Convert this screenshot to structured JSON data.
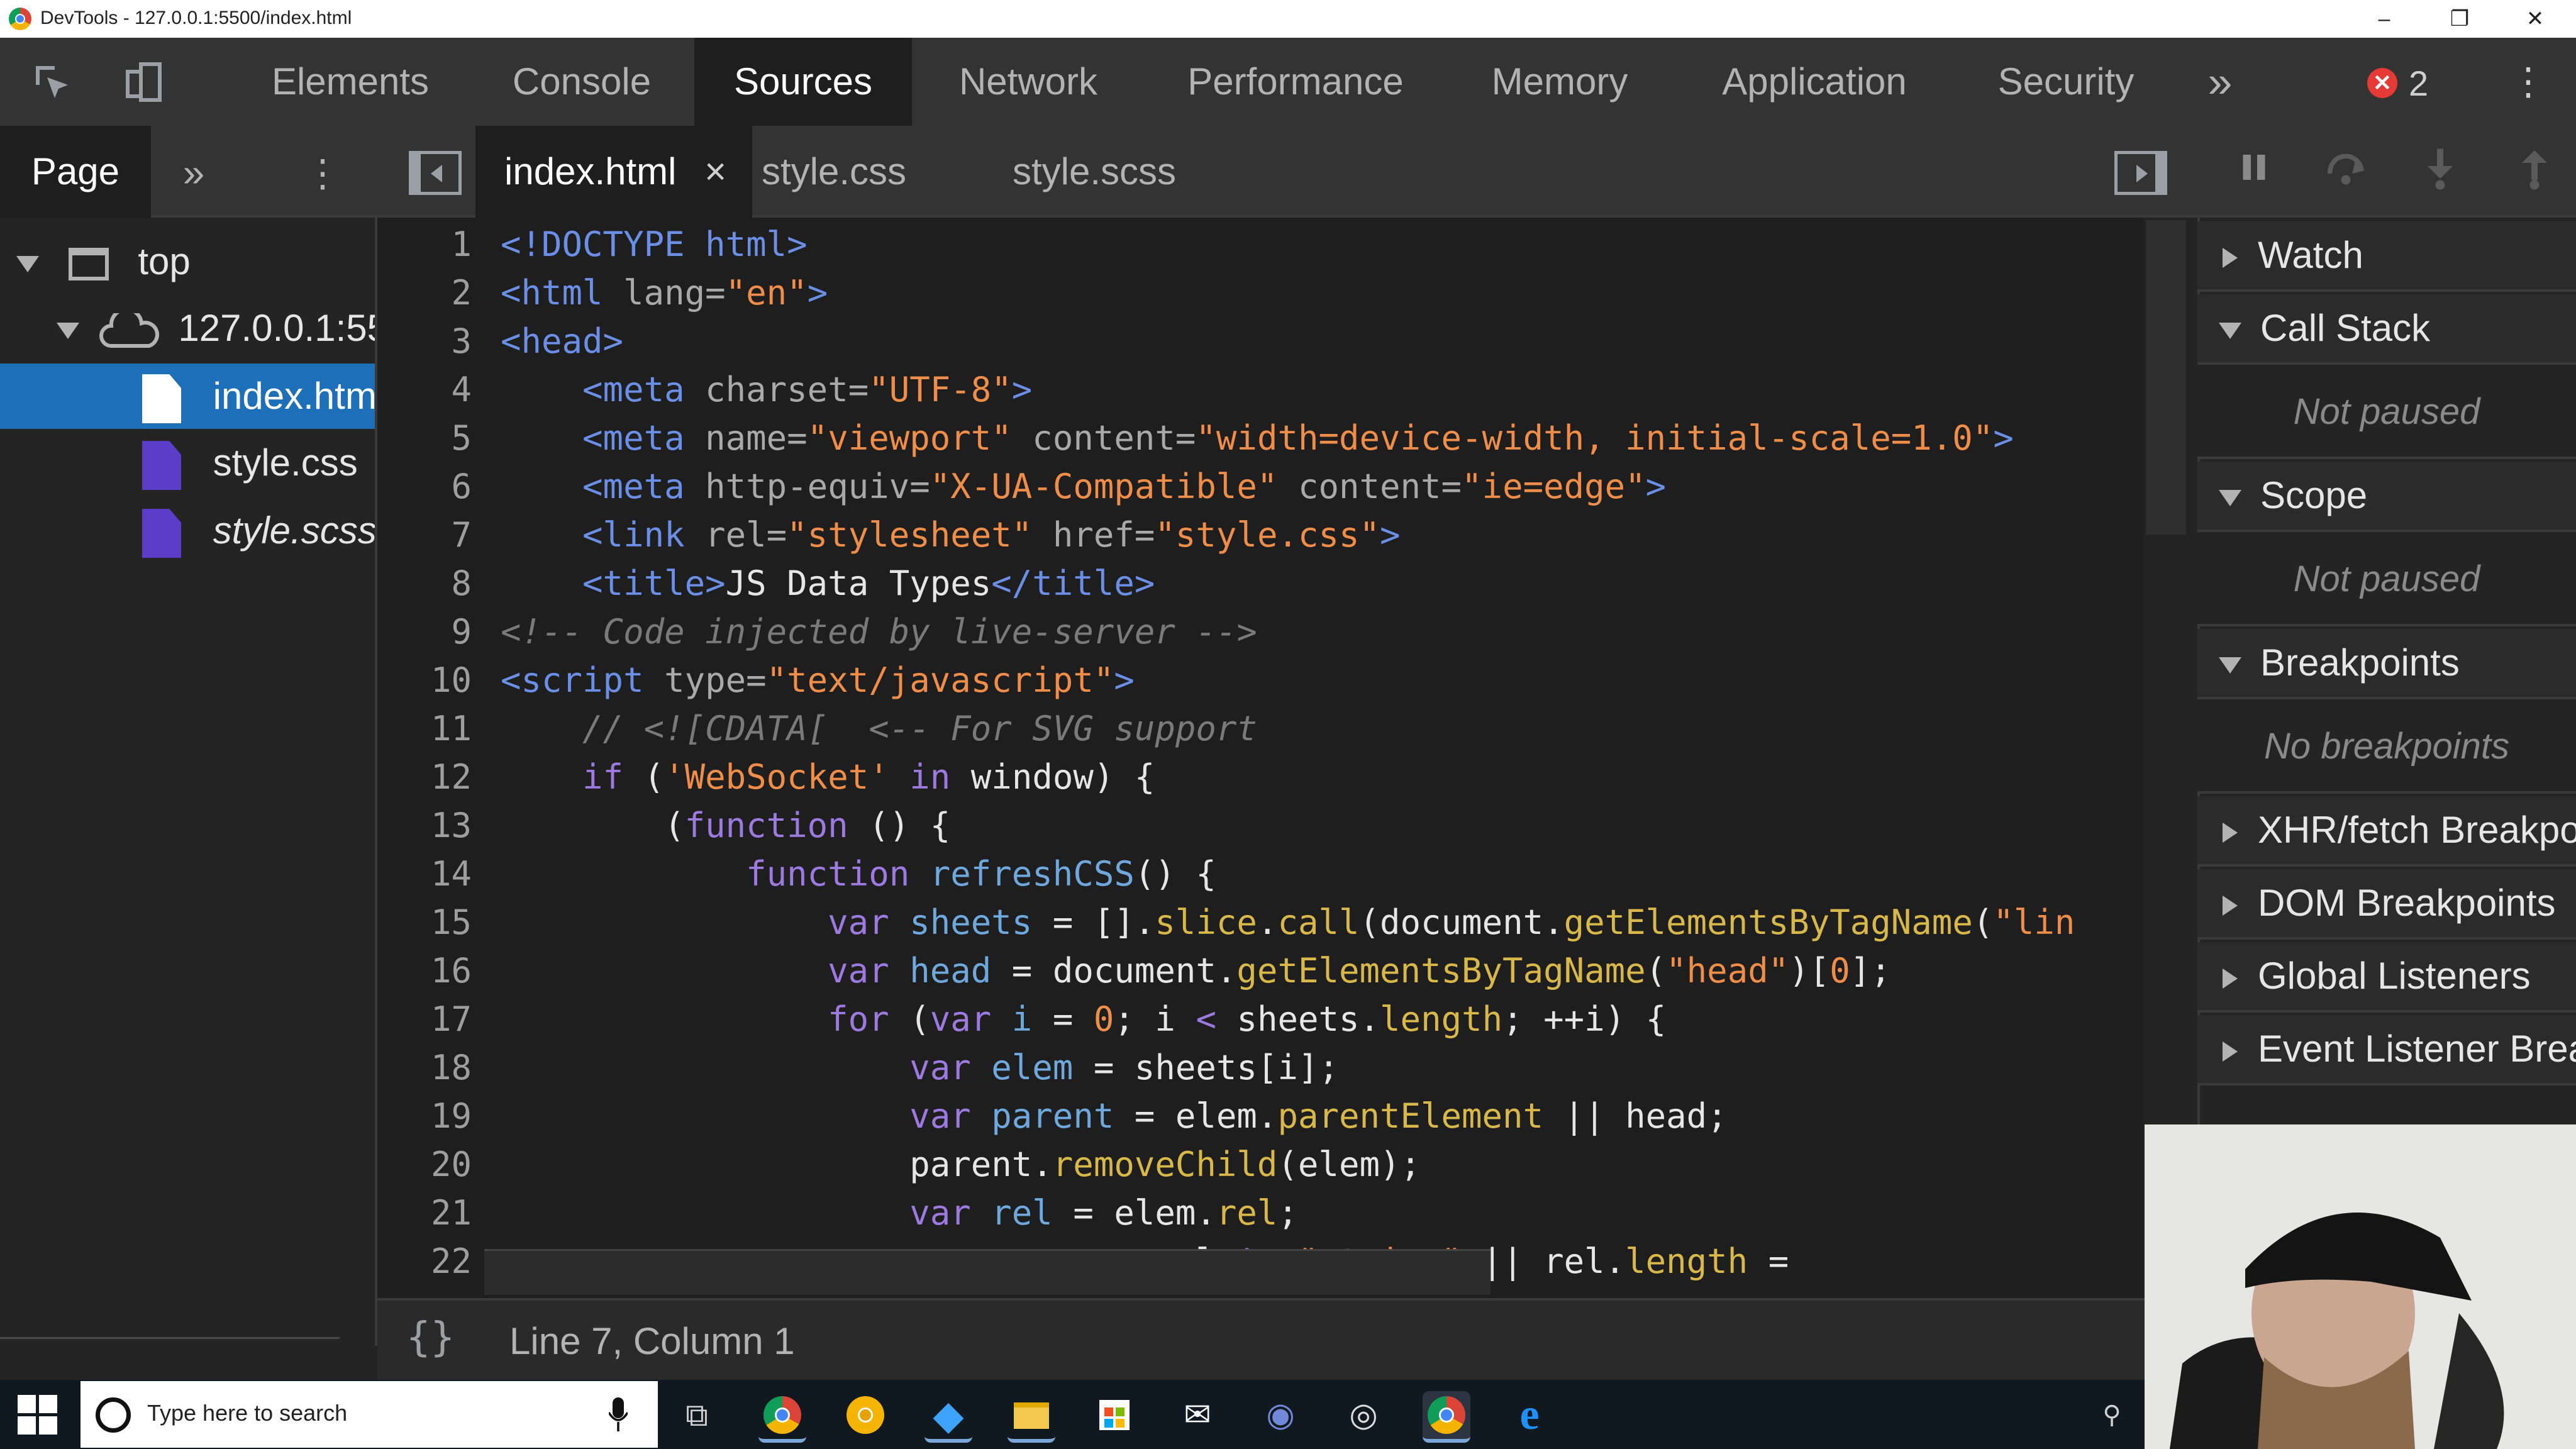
{
  "window": {
    "title": "DevTools - 127.0.0.1:5500/index.html",
    "controls": [
      "–",
      "❐",
      "✕"
    ]
  },
  "toolbar": {
    "inspect_icon": "inspect-element-icon",
    "device_icon": "device-toolbar-icon",
    "tabs": [
      "Elements",
      "Console",
      "Sources",
      "Network",
      "Performance",
      "Memory",
      "Application",
      "Security"
    ],
    "active_tab": "Sources",
    "more_tabs": "»",
    "error_badge": "✕",
    "error_count": "2",
    "menu": "⋮"
  },
  "navigator": {
    "tabs": [
      "Page"
    ],
    "more": "»",
    "menu": "⋮",
    "tree": [
      {
        "label": "top",
        "icon": "frame-icon"
      },
      {
        "label": "127.0.0.1:5500",
        "icon": "cloud-icon"
      },
      {
        "label": "index.html",
        "icon": "html-file-icon",
        "selected": true
      },
      {
        "label": "style.css",
        "icon": "css-file-icon"
      },
      {
        "label": "style.scss",
        "icon": "scss-file-icon"
      }
    ]
  },
  "editor": {
    "tabs": [
      {
        "label": "index.html",
        "close": "×",
        "active": true
      },
      {
        "label": "style.css"
      },
      {
        "label": "style.scss"
      }
    ],
    "line_numbers": [
      "1",
      "2",
      "3",
      "4",
      "5",
      "6",
      "7",
      "8",
      "9",
      "10",
      "11",
      "12",
      "13",
      "14",
      "15",
      "16",
      "17",
      "18",
      "19",
      "20",
      "21",
      "22"
    ],
    "lines": [
      [
        {
          "t": "k",
          "v": "<!DOCTYPE html>"
        }
      ],
      [
        {
          "t": "k",
          "v": "<html "
        },
        {
          "t": "a",
          "v": "lang="
        },
        {
          "t": "s",
          "v": "\"en\""
        },
        {
          "t": "k",
          "v": ">"
        }
      ],
      [
        {
          "t": "k",
          "v": "<head>"
        }
      ],
      [
        {
          "t": "tx",
          "v": "    "
        },
        {
          "t": "k",
          "v": "<meta "
        },
        {
          "t": "a",
          "v": "charset="
        },
        {
          "t": "s",
          "v": "\"UTF-8\""
        },
        {
          "t": "k",
          "v": ">"
        }
      ],
      [
        {
          "t": "tx",
          "v": "    "
        },
        {
          "t": "k",
          "v": "<meta "
        },
        {
          "t": "a",
          "v": "name="
        },
        {
          "t": "s",
          "v": "\"viewport\""
        },
        {
          "t": "a",
          "v": " content="
        },
        {
          "t": "s",
          "v": "\"width=device-width, initial-scale=1.0\""
        },
        {
          "t": "k",
          "v": ">"
        }
      ],
      [
        {
          "t": "tx",
          "v": "    "
        },
        {
          "t": "k",
          "v": "<meta "
        },
        {
          "t": "a",
          "v": "http-equiv="
        },
        {
          "t": "s",
          "v": "\"X-UA-Compatible\""
        },
        {
          "t": "a",
          "v": " content="
        },
        {
          "t": "s",
          "v": "\"ie=edge\""
        },
        {
          "t": "k",
          "v": ">"
        }
      ],
      [
        {
          "t": "tx",
          "v": "    "
        },
        {
          "t": "k",
          "v": "<link "
        },
        {
          "t": "a",
          "v": "rel="
        },
        {
          "t": "s",
          "v": "\"stylesheet\""
        },
        {
          "t": "a",
          "v": " href="
        },
        {
          "t": "s",
          "v": "\"style.css\""
        },
        {
          "t": "k",
          "v": ">"
        }
      ],
      [
        {
          "t": "tx",
          "v": "    "
        },
        {
          "t": "k",
          "v": "<title>"
        },
        {
          "t": "tx",
          "v": "JS Data Types"
        },
        {
          "t": "k",
          "v": "</title>"
        }
      ],
      [
        {
          "t": "c",
          "v": "<!-- Code injected by live-server -->"
        }
      ],
      [
        {
          "t": "k",
          "v": "<script "
        },
        {
          "t": "a",
          "v": "type="
        },
        {
          "t": "s",
          "v": "\"text/javascript\""
        },
        {
          "t": "k",
          "v": ">"
        }
      ],
      [
        {
          "t": "c",
          "v": "    // <![CDATA[  <-- For SVG support"
        }
      ],
      [
        {
          "t": "tx",
          "v": "    "
        },
        {
          "t": "kw",
          "v": "if"
        },
        {
          "t": "tx",
          "v": " ("
        },
        {
          "t": "s",
          "v": "'WebSocket'"
        },
        {
          "t": "kw",
          "v": " in"
        },
        {
          "t": "tx",
          "v": " window) {"
        }
      ],
      [
        {
          "t": "tx",
          "v": "        ("
        },
        {
          "t": "kw",
          "v": "function"
        },
        {
          "t": "tx",
          "v": " () {"
        }
      ],
      [
        {
          "t": "tx",
          "v": "            "
        },
        {
          "t": "kw",
          "v": "function"
        },
        {
          "t": "vr",
          "v": " refreshCSS"
        },
        {
          "t": "tx",
          "v": "() {"
        }
      ],
      [
        {
          "t": "tx",
          "v": "                "
        },
        {
          "t": "kw",
          "v": "var"
        },
        {
          "t": "vr",
          "v": " sheets"
        },
        {
          "t": "tx",
          "v": " = []."
        },
        {
          "t": "fn",
          "v": "slice"
        },
        {
          "t": "tx",
          "v": "."
        },
        {
          "t": "fn",
          "v": "call"
        },
        {
          "t": "tx",
          "v": "(document."
        },
        {
          "t": "fn",
          "v": "getElementsByTagName"
        },
        {
          "t": "tx",
          "v": "("
        },
        {
          "t": "s",
          "v": "\"lin"
        }
      ],
      [
        {
          "t": "tx",
          "v": "                "
        },
        {
          "t": "kw",
          "v": "var"
        },
        {
          "t": "vr",
          "v": " head"
        },
        {
          "t": "tx",
          "v": " = document."
        },
        {
          "t": "fn",
          "v": "getElementsByTagName"
        },
        {
          "t": "tx",
          "v": "("
        },
        {
          "t": "s",
          "v": "\"head\""
        },
        {
          "t": "tx",
          "v": ")["
        },
        {
          "t": "num",
          "v": "0"
        },
        {
          "t": "tx",
          "v": "];"
        }
      ],
      [
        {
          "t": "tx",
          "v": "                "
        },
        {
          "t": "kw",
          "v": "for"
        },
        {
          "t": "tx",
          "v": " ("
        },
        {
          "t": "kw",
          "v": "var"
        },
        {
          "t": "vr",
          "v": " i"
        },
        {
          "t": "tx",
          "v": " = "
        },
        {
          "t": "num",
          "v": "0"
        },
        {
          "t": "tx",
          "v": "; i "
        },
        {
          "t": "kw",
          "v": "<"
        },
        {
          "t": "tx",
          "v": " sheets."
        },
        {
          "t": "fn",
          "v": "length"
        },
        {
          "t": "tx",
          "v": "; ++i) {"
        }
      ],
      [
        {
          "t": "tx",
          "v": "                    "
        },
        {
          "t": "kw",
          "v": "var"
        },
        {
          "t": "vr",
          "v": " elem"
        },
        {
          "t": "tx",
          "v": " = sheets[i];"
        }
      ],
      [
        {
          "t": "tx",
          "v": "                    "
        },
        {
          "t": "kw",
          "v": "var"
        },
        {
          "t": "vr",
          "v": " parent"
        },
        {
          "t": "tx",
          "v": " = elem."
        },
        {
          "t": "fn",
          "v": "parentElement"
        },
        {
          "t": "tx",
          "v": " || head;"
        }
      ],
      [
        {
          "t": "tx",
          "v": "                    parent."
        },
        {
          "t": "fn",
          "v": "removeChild"
        },
        {
          "t": "tx",
          "v": "(elem);"
        }
      ],
      [
        {
          "t": "tx",
          "v": "                    "
        },
        {
          "t": "kw",
          "v": "var"
        },
        {
          "t": "vr",
          "v": " rel"
        },
        {
          "t": "tx",
          "v": " = elem."
        },
        {
          "t": "fn",
          "v": "rel"
        },
        {
          "t": "tx",
          "v": ";"
        }
      ],
      [
        {
          "t": "tx",
          "v": "                                 el "
        },
        {
          "t": "kw",
          "v": "!="
        },
        {
          "t": "s",
          "v": " \"string\""
        },
        {
          "t": "tx",
          "v": " || rel."
        },
        {
          "t": "fn",
          "v": "length"
        },
        {
          "t": "tx",
          "v": " ="
        }
      ]
    ]
  },
  "status": {
    "pretty_print": "{}",
    "cursor": "Line 7, Column 1"
  },
  "debugger": {
    "sections": [
      {
        "label": "Watch",
        "expanded": false
      },
      {
        "label": "Call Stack",
        "expanded": true,
        "body": "Not paused"
      },
      {
        "label": "Scope",
        "expanded": true,
        "body": "Not paused"
      },
      {
        "label": "Breakpoints",
        "expanded": true,
        "body": "No breakpoints"
      },
      {
        "label": "XHR/fetch Breakpoints",
        "expanded": false
      },
      {
        "label": "DOM Breakpoints",
        "expanded": false
      },
      {
        "label": "Global Listeners",
        "expanded": false
      },
      {
        "label": "Event Listener Breakpoints",
        "expanded": false
      }
    ]
  },
  "taskbar": {
    "search_placeholder": "Type here to search",
    "apps": [
      {
        "name": "task-view-icon",
        "glyph": "⧉"
      },
      {
        "name": "chrome-icon",
        "glyph": "●"
      },
      {
        "name": "chrome-canary-icon",
        "glyph": "●"
      },
      {
        "name": "vscode-icon",
        "glyph": "◆"
      },
      {
        "name": "file-explorer-icon",
        "glyph": "▬"
      },
      {
        "name": "store-icon",
        "glyph": "▦"
      },
      {
        "name": "mail-icon",
        "glyph": "✉"
      },
      {
        "name": "discord-icon",
        "glyph": "◉"
      },
      {
        "name": "obs-icon",
        "glyph": "◎"
      },
      {
        "name": "chrome-active-icon",
        "glyph": "●"
      },
      {
        "name": "edge-icon",
        "glyph": "e"
      }
    ]
  }
}
